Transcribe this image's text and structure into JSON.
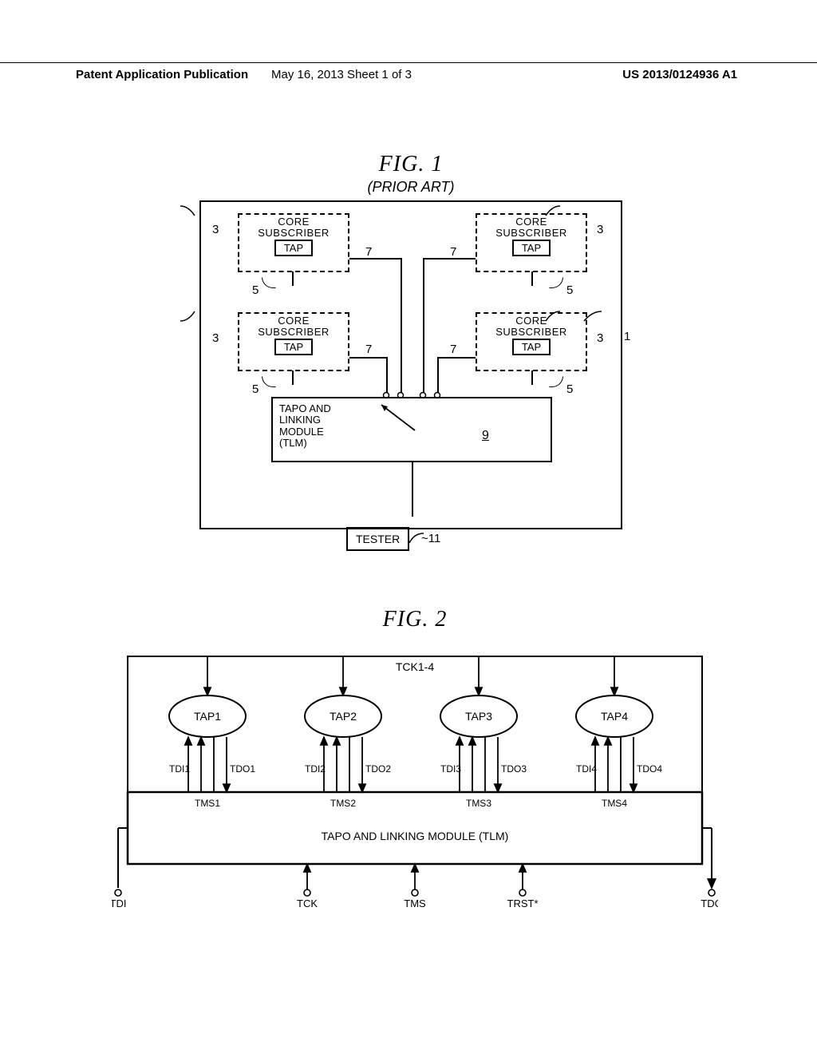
{
  "header": {
    "left": "Patent Application Publication",
    "center": "May 16, 2013   Sheet 1 of 3",
    "right": "US 2013/0124936 A1"
  },
  "fig1": {
    "title": "FIG.   1",
    "subtitle": "(PRIOR ART)",
    "core_label_l1": "CORE",
    "core_label_l2": "SUBSCRIBER",
    "tap_label": "TAP",
    "ref3": "3",
    "ref5": "5",
    "ref7": "7",
    "ref1": "1",
    "ref9": "9",
    "ref11": "11",
    "tlm_l1": "TAPO AND",
    "tlm_l2": "LINKING",
    "tlm_l3": "MODULE",
    "tlm_l4": "(TLM)",
    "tester": "TESTER"
  },
  "fig2": {
    "title": "FIG.   2",
    "tck_top": "TCK1-4",
    "taps": [
      "TAP1",
      "TAP2",
      "TAP3",
      "TAP4"
    ],
    "tdi": [
      "TDI1",
      "TDI2",
      "TDI3",
      "TDI4"
    ],
    "tdo": [
      "TDO1",
      "TDO2",
      "TDO3",
      "TDO4"
    ],
    "tms": [
      "TMS1",
      "TMS2",
      "TMS3",
      "TMS4"
    ],
    "tlm_label": "TAPO AND LINKING MODULE (TLM)",
    "bottom_pins": [
      "TDI",
      "TCK",
      "TMS",
      "TRST*",
      "TDO"
    ]
  },
  "chart_data": {
    "type": "diagram",
    "description": "Two technical figures from a patent application",
    "figure1": {
      "title": "FIG. 1 (PRIOR ART)",
      "outer_block_id": 1,
      "components": [
        {
          "id": 3,
          "name": "CORE SUBSCRIBER",
          "count": 4,
          "contains": {
            "id": 5,
            "name": "TAP"
          }
        },
        {
          "id": 7,
          "name": "connection line",
          "count": 4
        },
        {
          "id": 9,
          "name": "TAPO AND LINKING MODULE (TLM)"
        },
        {
          "id": 11,
          "name": "TESTER",
          "external": true
        }
      ],
      "connections": [
        {
          "from": "TAP(5) x4",
          "via": "line(7)",
          "to": "TLM(9)"
        },
        {
          "from": "TLM(9)",
          "to": "TESTER(11)"
        }
      ]
    },
    "figure2": {
      "title": "FIG. 2",
      "taps": [
        {
          "name": "TAP1",
          "signals": {
            "tdi": "TDI1",
            "tdo": "TDO1",
            "tms": "TMS1",
            "tck": "TCK1-4"
          }
        },
        {
          "name": "TAP2",
          "signals": {
            "tdi": "TDI2",
            "tdo": "TDO2",
            "tms": "TMS2",
            "tck": "TCK1-4"
          }
        },
        {
          "name": "TAP3",
          "signals": {
            "tdi": "TDI3",
            "tdo": "TDO3",
            "tms": "TMS3",
            "tck": "TCK1-4"
          }
        },
        {
          "name": "TAP4",
          "signals": {
            "tdi": "TDI4",
            "tdo": "TDO4",
            "tms": "TMS4",
            "tck": "TCK1-4"
          }
        }
      ],
      "module": "TAPO AND LINKING MODULE (TLM)",
      "external_pins": [
        "TDI",
        "TCK",
        "TMS",
        "TRST*",
        "TDO"
      ]
    }
  }
}
